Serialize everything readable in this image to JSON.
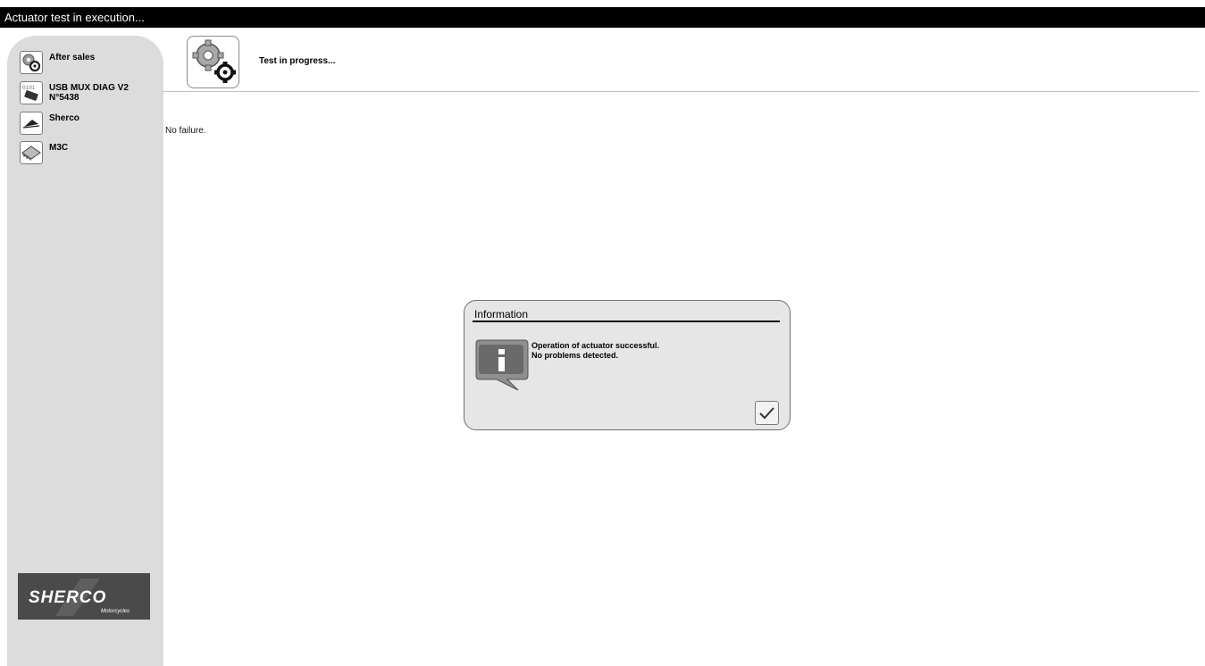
{
  "window": {
    "title": "Actuator test in execution..."
  },
  "sidebar": {
    "items": [
      {
        "label": "After sales",
        "sub": "",
        "icon": "gears-icon"
      },
      {
        "label": "USB MUX DIAG V2",
        "sub": "N°5438",
        "icon": "usb-interface-icon"
      },
      {
        "label": "Sherco",
        "sub": "",
        "icon": "sherco-brand-icon"
      },
      {
        "label": "M3C",
        "sub": "",
        "icon": "ecu-module-icon"
      }
    ],
    "logo_text": "SHERCO",
    "logo_subtext": "Motorcycles"
  },
  "header": {
    "title": "Test in progress...",
    "icon": "gears-icon"
  },
  "status": {
    "text": "No failure."
  },
  "dialog": {
    "title": "Information",
    "message_line1": "Operation of actuator successful.",
    "message_line2": "No problems detected.",
    "icon": "info-bubble-icon",
    "confirm_icon": "checkmark-icon"
  },
  "colors": {
    "titlebar": "#000000",
    "sidebar": "#dcdcdc",
    "dialog": "#e6e6e6"
  }
}
